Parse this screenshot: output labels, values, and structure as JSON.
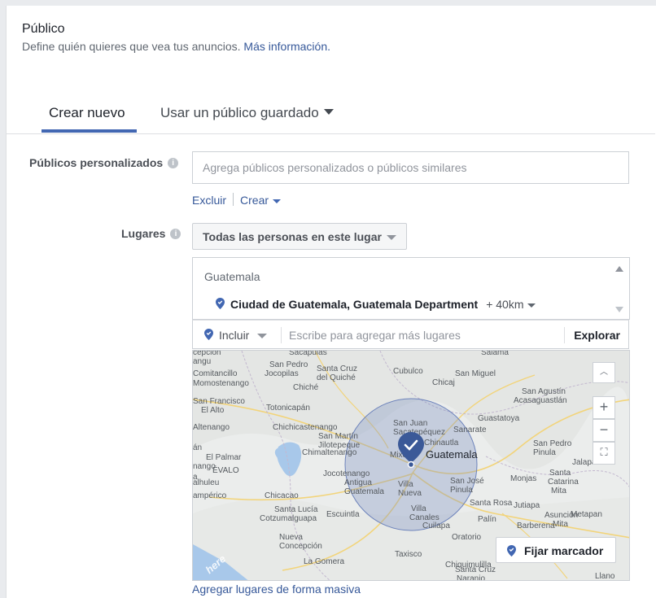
{
  "header": {
    "title": "Público",
    "subtitle": "Define quién quieres que vea tus anuncios.",
    "more_info": "Más información."
  },
  "tabs": [
    {
      "label": "Crear nuevo",
      "active": true
    },
    {
      "label": "Usar un público guardado",
      "active": false
    }
  ],
  "custom_audiences": {
    "label": "Públicos personalizados",
    "info_glyph": "i",
    "placeholder": "Agrega públicos personalizados o públicos similares",
    "exclude_label": "Excluir",
    "create_label": "Crear"
  },
  "locations": {
    "label": "Lugares",
    "info_glyph": "i",
    "selector_value": "Todas las personas en este lugar",
    "country": "Guatemala",
    "city": "Ciudad de Guatemala, Guatemala Department",
    "radius": "+ 40km",
    "include_label": "Incluir",
    "search_placeholder": "Escribe para agregar más lugares",
    "explore_label": "Explorar",
    "bulk_label": "Agregar lugares de forma masiva"
  },
  "map": {
    "center_label": "Guatemala",
    "places": [
      "Sacapulas",
      "Salamá",
      "Comitancillo",
      "San Pedro",
      "Jocopilas",
      "Santa Cruz del Quiché",
      "Cubulco",
      "San Miguel Chicaj",
      "Momostenango",
      "Chiché",
      "San Agustín Acasaguastlán",
      "San Francisco",
      "El Alto",
      "Totonicapán",
      "Guastatoya",
      "Chichicastenango",
      "San Juan Sacatepéquez",
      "Sanarate",
      "Altenango",
      "San Martín Jilotepeque",
      "Chinautla",
      "San Pedro Pinula",
      "El Palmar",
      "Chimaltenango",
      "Mixco",
      "Jalapa",
      "Jocotenango",
      "Villa Nueva",
      "San José Pinula",
      "Monjas",
      "Santa Catarina Mita",
      "Antigua Guatemala",
      "Santa Rosa",
      "Chicacao",
      "Jutiapa",
      "Santa Lucía Cotzumalguapa",
      "Escuintla",
      "Villa Canales",
      "Asunción Mita",
      "Metapan",
      "Nueva Concepción",
      "Oratorio",
      "La Gomera",
      "Taxisco",
      "Chiquimulilla",
      "Cuilapa",
      "Santa Cruz Naranjo",
      "Barberena",
      "Palín"
    ],
    "zoom_in": "+",
    "zoom_out": "−",
    "watermark": "here",
    "pin_marker_label": "Fijar marcador"
  },
  "colors": {
    "accent": "#4267b2",
    "link": "#365899",
    "pin": "#4267b2",
    "radius_fill": "#7e92c4"
  },
  "icons": {
    "info": "info-icon",
    "pin": "location-pin-icon",
    "caret": "caret-down-icon",
    "locate": "locate-icon"
  }
}
